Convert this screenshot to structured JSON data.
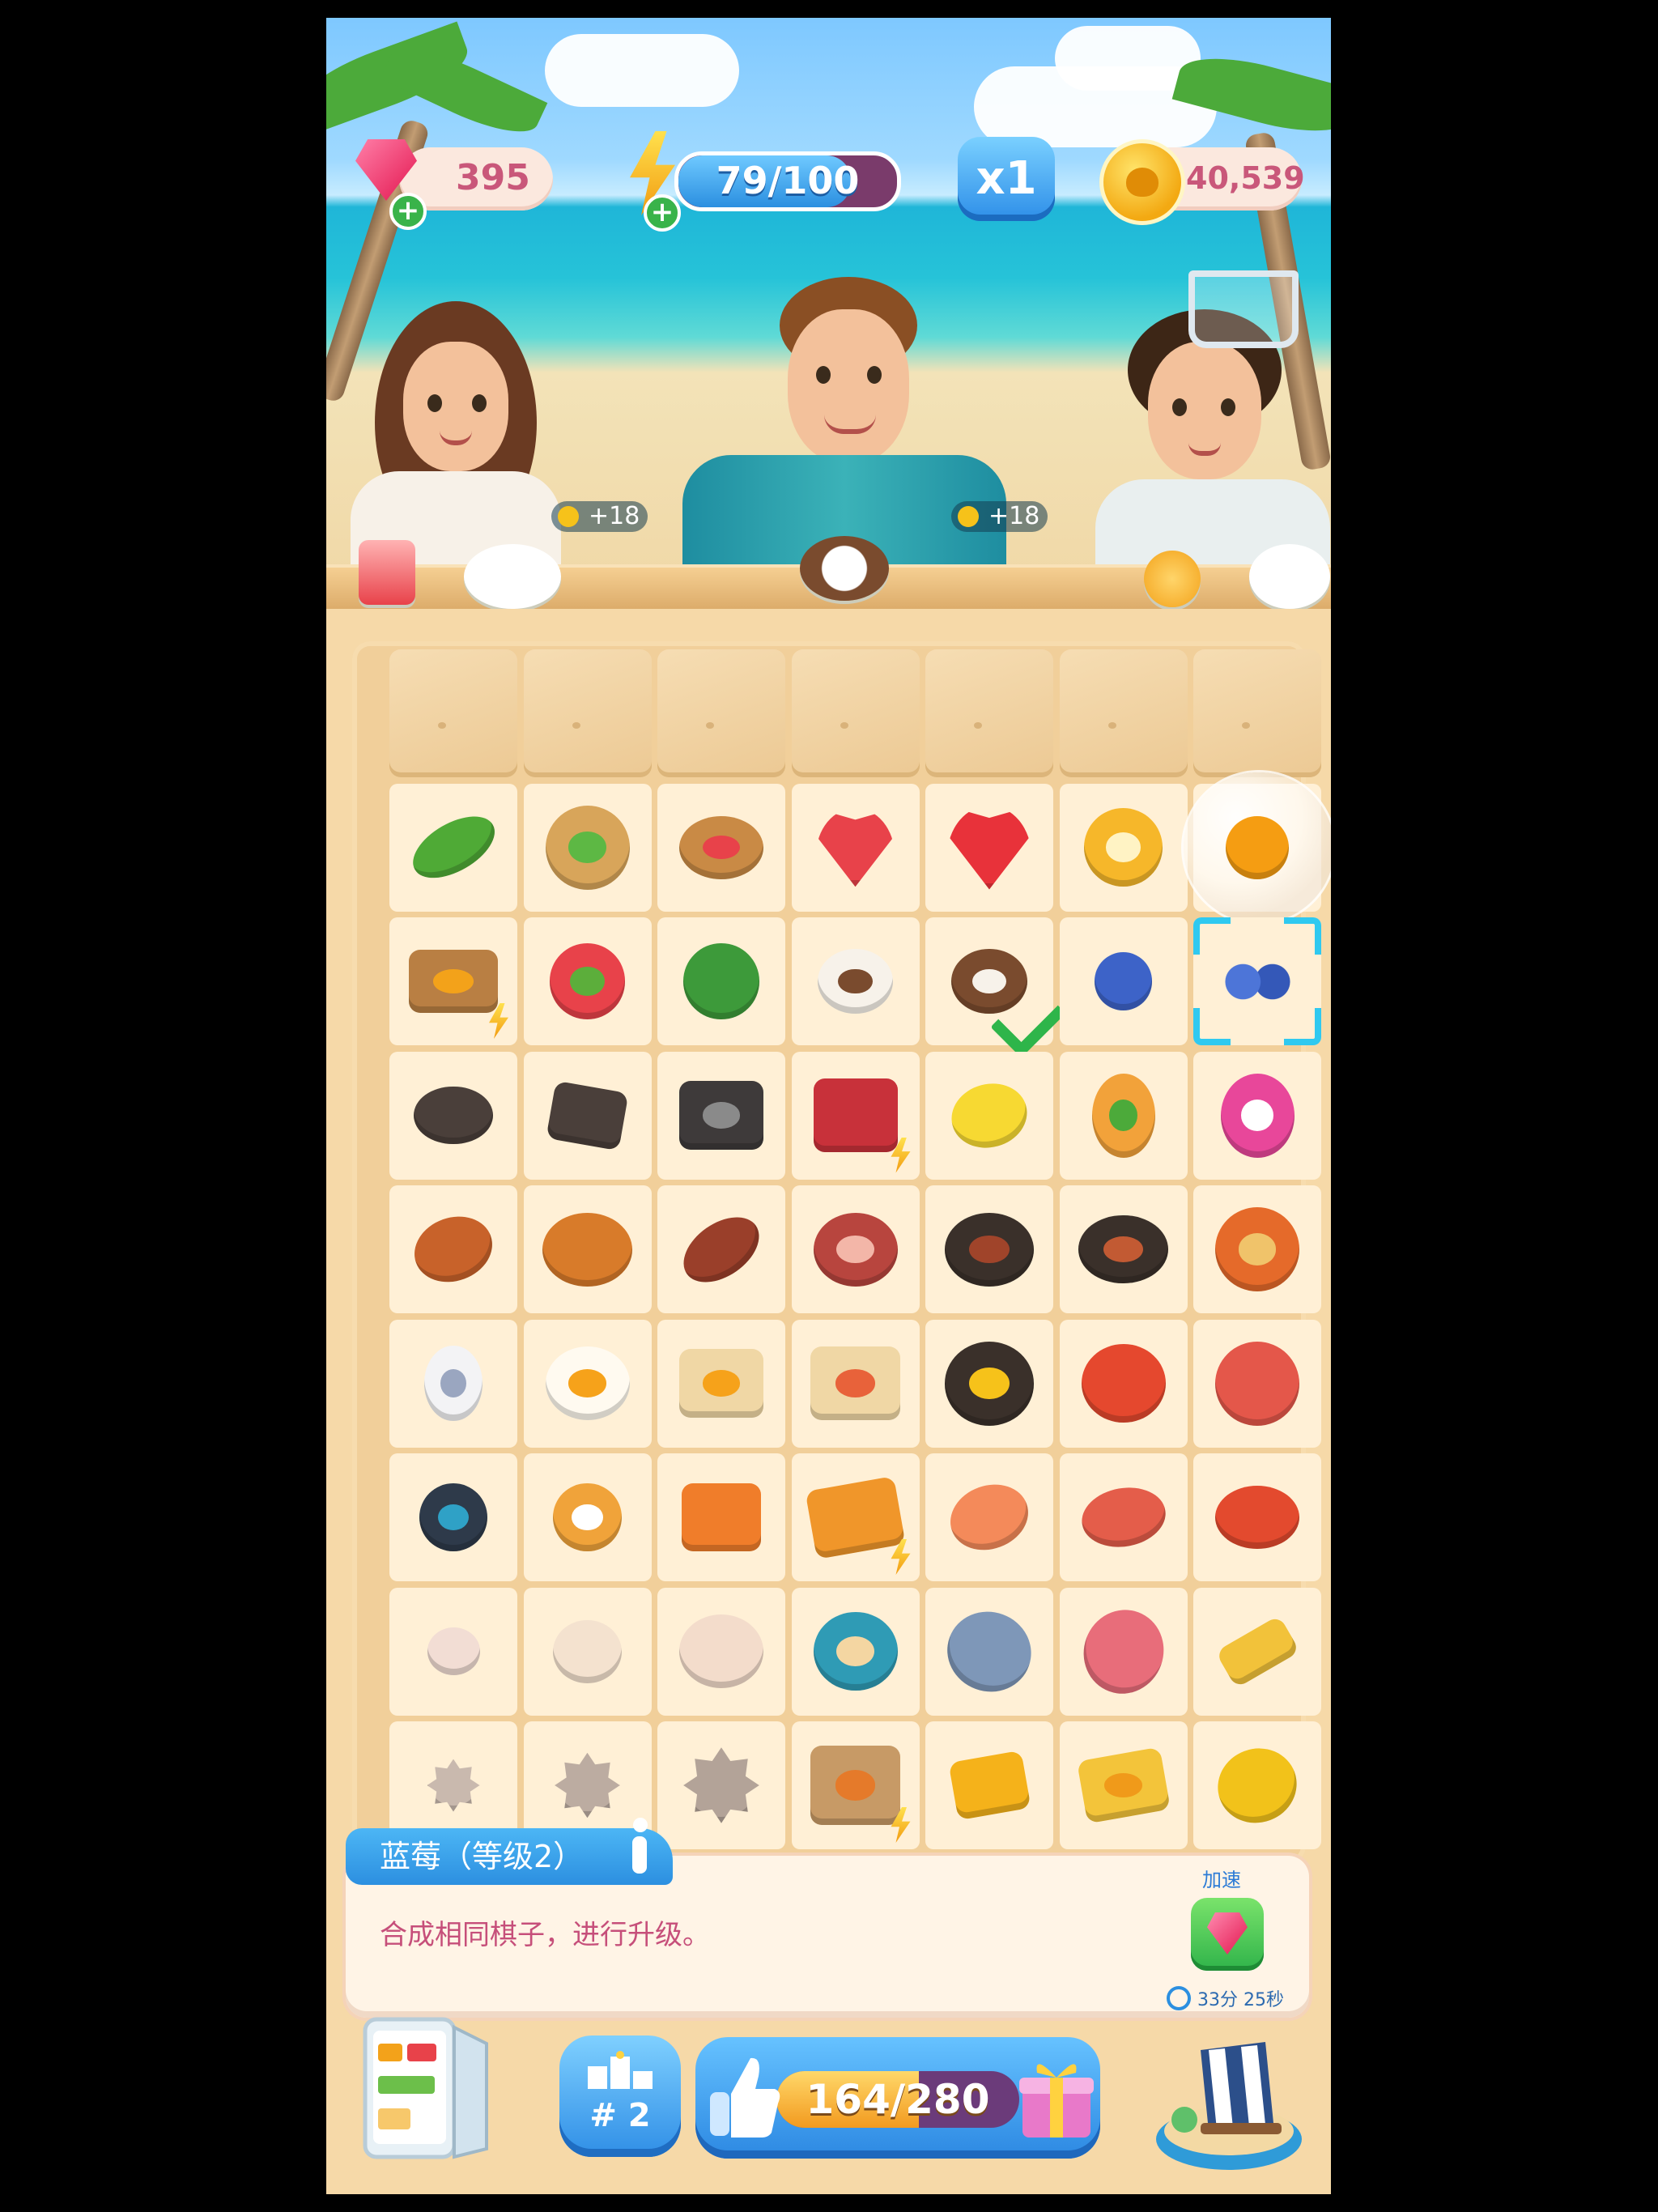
{
  "hud": {
    "gems": "395",
    "energy_text": "79/100",
    "energy_fraction": 0.79,
    "multiplier": "x1",
    "coins": "40,539"
  },
  "customers": [
    {
      "bonus": "+18"
    },
    {
      "bonus": "+18"
    }
  ],
  "board": {
    "rows": [
      [
        "sand",
        "sand",
        "sand",
        "sand",
        "sand",
        "sand",
        "sand"
      ],
      [
        "leaf",
        "leaf-tart",
        "fruit-tart",
        "strawberry-half",
        "strawberry",
        "orange-slice-web",
        "orange-bubble"
      ],
      [
        "fruit-crate",
        "watermelon-slice",
        "watermelon",
        "coconut",
        "coconut-pair",
        "blueberry",
        "blueberry-pair"
      ],
      [
        "pan-round",
        "skillet",
        "grill",
        "bbq-grill",
        "lemon",
        "pineapple",
        "dragonfruit"
      ],
      [
        "drumstick",
        "roast-chicken",
        "sausages",
        "ham",
        "steak-plate",
        "roast-plate",
        "seafood-pot"
      ],
      [
        "egg",
        "fried-egg",
        "egg-toast",
        "egg-toast-bacon",
        "breakfast-plate",
        "lobster",
        "octopus"
      ],
      [
        "fishing-reel",
        "fishing-net",
        "bucket",
        "tackle-box",
        "shrimp",
        "fish",
        "crab"
      ],
      [
        "shell-small",
        "shell",
        "shell-large",
        "starfish-shell",
        "conch",
        "murex-shell",
        "broom"
      ],
      [
        "gear-small",
        "gear",
        "gear-large",
        "workbench",
        "cheese-cube",
        "sponge-cake",
        "gloves"
      ]
    ]
  },
  "info": {
    "title": "蓝莓（等级2）",
    "description": "合成相同棋子，进行升级。",
    "speed_label": "加速",
    "timer": "33分 25秒"
  },
  "bottom": {
    "rank": "# 2",
    "progress_text": "164/280",
    "progress_fraction": 0.586
  },
  "colors": {
    "accent_blue": "#2c8fe0",
    "gem_pink": "#e3164f",
    "text_pink": "#c9577a",
    "board_bg": "#f1cf9a"
  }
}
